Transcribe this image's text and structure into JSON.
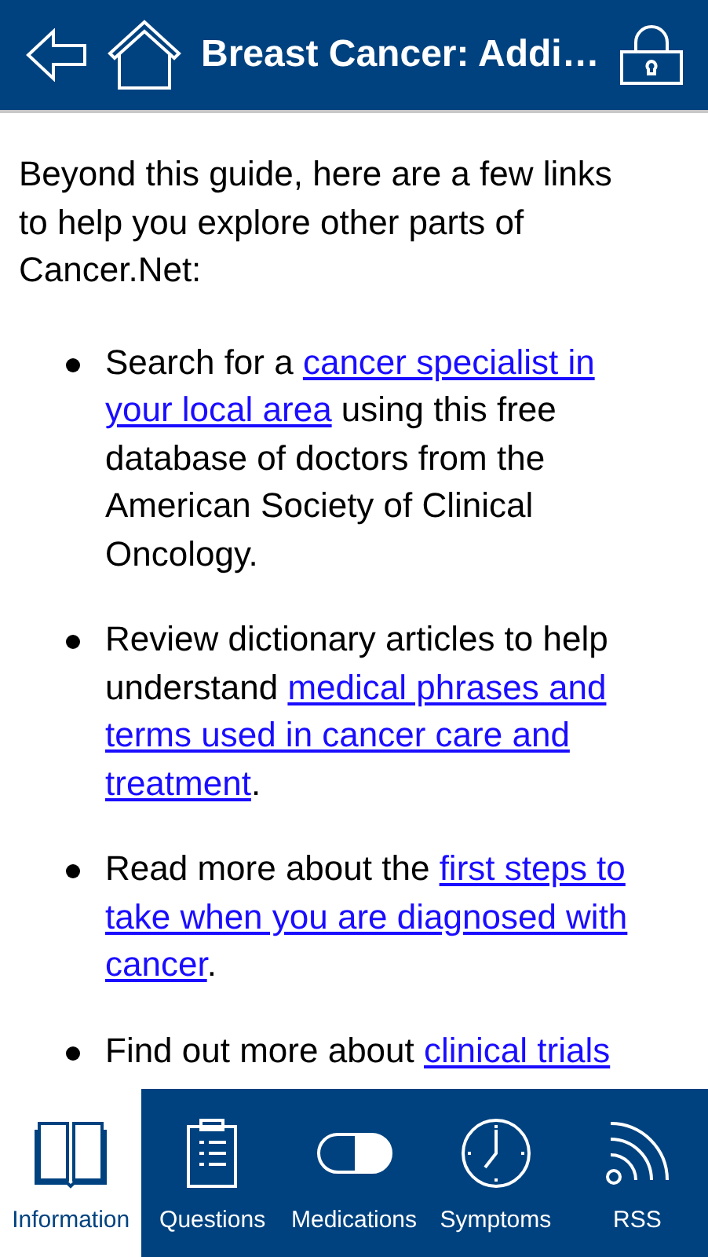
{
  "header": {
    "title": "Breast Cancer: Addi…"
  },
  "intro": "Beyond this guide, here are a few links to help you explore other parts of Cancer.Net:",
  "bullets": [
    {
      "segments": [
        {
          "kind": "text",
          "text": "Search for a "
        },
        {
          "kind": "link",
          "text": "cancer specialist in"
        },
        {
          "kind": "link",
          "text": "your local area"
        },
        {
          "kind": "text",
          "text": " using this free database of doctors from the American Society of Clinical Oncology."
        }
      ]
    },
    {
      "segments": [
        {
          "kind": "text",
          "text": "Review dictionary articles to help understand "
        },
        {
          "kind": "link",
          "text": "medical phrases and"
        },
        {
          "kind": "link",
          "text": "terms used in cancer care and"
        },
        {
          "kind": "link",
          "text": "treatment"
        },
        {
          "kind": "text",
          "text": "."
        }
      ]
    },
    {
      "segments": [
        {
          "kind": "text",
          "text": "Read more about the "
        },
        {
          "kind": "link",
          "text": "first steps to"
        },
        {
          "kind": "link",
          "text": "take when you are diagnosed with"
        },
        {
          "kind": "link",
          "text": "cancer"
        },
        {
          "kind": "text",
          "text": "."
        }
      ]
    },
    {
      "segments": [
        {
          "kind": "text",
          "text": "Find out more about "
        },
        {
          "kind": "link",
          "text": "clinical trials"
        }
      ]
    }
  ],
  "tabs": [
    {
      "label": "Information",
      "selected": true
    },
    {
      "label": "Questions",
      "selected": false
    },
    {
      "label": "Medications",
      "selected": false
    },
    {
      "label": "Symptoms",
      "selected": false
    },
    {
      "label": "RSS",
      "selected": false
    }
  ]
}
